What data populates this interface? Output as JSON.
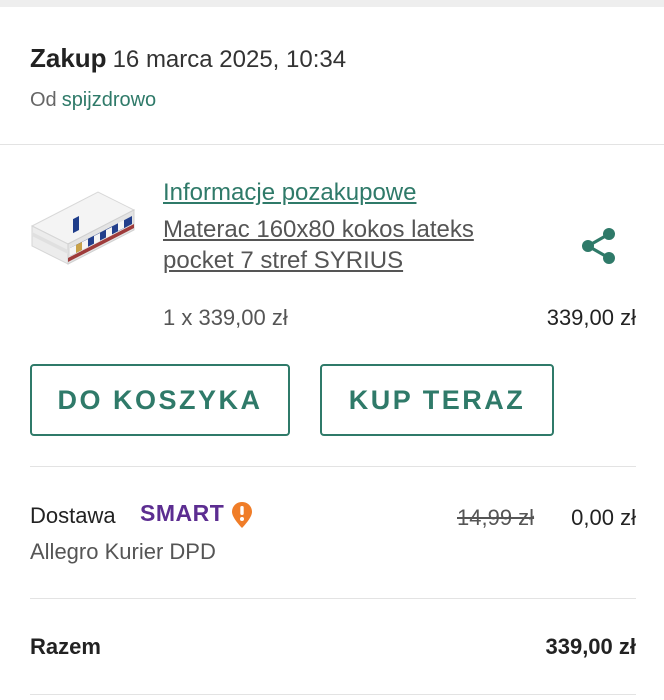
{
  "purchase": {
    "title": "Zakup",
    "date": "16 marca 2025, 10:34",
    "seller_prefix": "Od",
    "seller_name": "spijzdrowo"
  },
  "product": {
    "after_purchase_link": "Informacje pozakupowe",
    "name": "Materac 160x80 kokos lateks pocket 7 stref SYRIUS",
    "quantity_price": "1 x 339,00 zł",
    "line_total": "339,00 zł",
    "image_icon": "mattress-image",
    "share_icon": "share-icon"
  },
  "actions": {
    "add_to_cart": "DO KOSZYKA",
    "buy_now": "KUP TERAZ"
  },
  "delivery": {
    "label": "Dostawa",
    "badge": "SMART",
    "badge_icon": "smart-exclamation-icon",
    "old_price": "14,99 zł",
    "price": "0,00 zł",
    "carrier": "Allegro Kurier DPD"
  },
  "summary": {
    "total_label": "Razem",
    "total_value": "339,00 zł"
  },
  "colors": {
    "accent": "#2f7a69",
    "smart_purple": "#5c2d91",
    "smart_orange": "#f07d28"
  }
}
